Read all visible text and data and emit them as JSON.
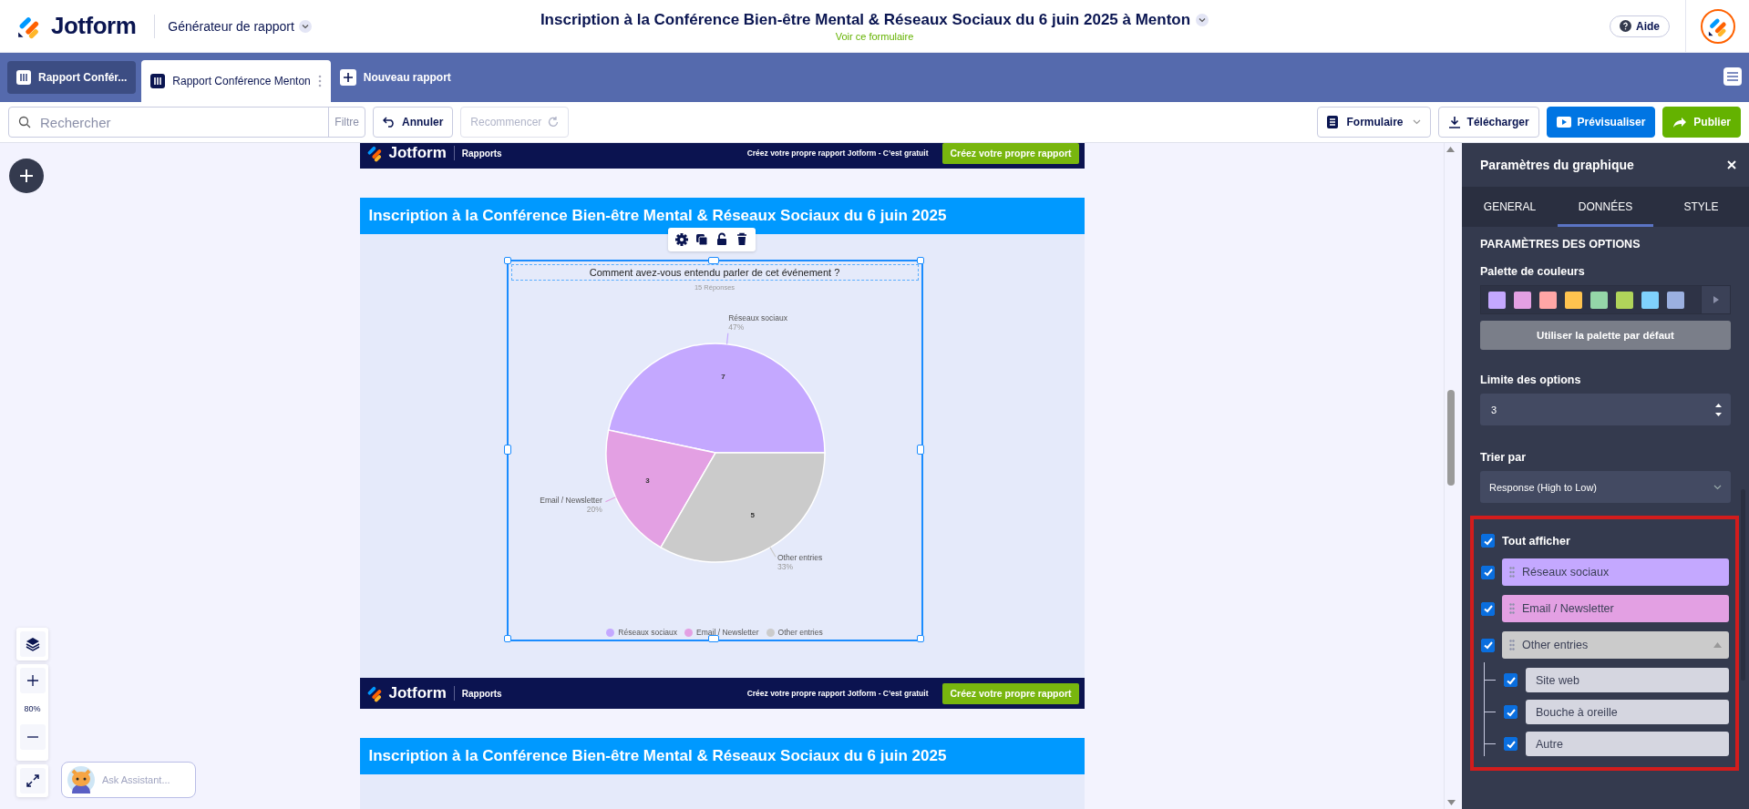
{
  "header": {
    "brand": "Jotform",
    "app_menu": "Générateur de rapport",
    "form_title": "Inscription à la Conférence Bien-être Mental & Réseaux Sociaux du 6 juin 2025 à Menton",
    "form_link": "Voir ce formulaire",
    "help": "Aide"
  },
  "tabs": [
    {
      "label": "Rapport Confér...",
      "selected": false
    },
    {
      "label": "Rapport Conférence Menton",
      "selected": true
    }
  ],
  "new_tab": "Nouveau rapport",
  "toolbar": {
    "search": {
      "placeholder": "Rechercher"
    },
    "filter": "Filtre",
    "undo": {
      "label": "Annuler",
      "disabled": false
    },
    "redo": {
      "label": "Recommencer",
      "disabled": true
    },
    "actions": [
      {
        "kind": "select",
        "label": "Formulaire"
      },
      {
        "kind": "download",
        "label": "Télécharger"
      },
      {
        "kind": "preview",
        "label": "Prévisualiser"
      },
      {
        "kind": "publish",
        "label": "Publier"
      }
    ]
  },
  "report": {
    "bands": [
      {
        "brand": "Jotform",
        "section": "Rapports",
        "promo": "Créez votre propre rapport Jotform - C’est gratuit",
        "cta": "Créez votre propre rapport"
      },
      {
        "brand": "Jotform",
        "section": "Rapports",
        "promo": "Créez votre propre rapport Jotform - C’est gratuit",
        "cta": "Créez votre propre rapport"
      }
    ],
    "pages": [
      {
        "title": "Inscription à la Conférence Bien-être Mental & Réseaux Sociaux du 6 juin 2025"
      },
      {
        "title": "Inscription à la Conférence Bien-être Mental & Réseaux Sociaux du 6 juin 2025"
      }
    ],
    "chart": {
      "responses": "15 Réponses",
      "percent_labels": [
        "47%",
        "20%",
        "33%"
      ],
      "chart_data": {
        "type": "pie",
        "title": "Comment avez-vous entendu parler de cet événement ?",
        "categories": [
          "Réseaux sociaux",
          "Email / Newsletter",
          "Other entries"
        ],
        "values": [
          7,
          3,
          5
        ],
        "data_labels": true
      },
      "legend": [
        {
          "label": "Réseaux sociaux",
          "color": "#c4a8ff"
        },
        {
          "label": "Email / Newsletter",
          "color": "#e3a0e3"
        },
        {
          "label": "Other entries",
          "color": "#cbcbcb"
        }
      ]
    }
  },
  "zoom": {
    "level": "80%"
  },
  "assistant": {
    "placeholder": "Ask Assistant..."
  },
  "panel": {
    "title": "Paramètres du graphique",
    "tabs": [
      {
        "label": "GENERAL",
        "selected": false
      },
      {
        "label": "DONNÉES",
        "selected": true
      },
      {
        "label": "STYLE",
        "selected": false
      }
    ],
    "section": "PARAMÈTRES DES OPTIONS",
    "palette_label": "Palette de couleurs",
    "palette": [
      {
        "color": "#c4a8ff"
      },
      {
        "color": "#e3a0e3"
      },
      {
        "color": "#ffa6a6"
      },
      {
        "color": "#ffc34f"
      },
      {
        "color": "#94d6a8"
      },
      {
        "color": "#b0d45a"
      },
      {
        "color": "#7fd1fc"
      },
      {
        "color": "#9bb0e0"
      }
    ],
    "default_palette": "Utiliser la palette par défaut",
    "limit_label": "Limite des options",
    "limit_value": "3",
    "sort_label": "Trier par",
    "sort_value": "Response (High to Low)",
    "show_all": {
      "label": "Tout afficher",
      "checked": true
    },
    "options": [
      {
        "label": "Réseaux sociaux",
        "color": "#c4a8ff",
        "checked": true
      },
      {
        "label": "Email / Newsletter",
        "color": "#e3a0e3",
        "checked": true
      },
      {
        "label": "Other entries",
        "color": "#cbcbcb",
        "checked": true,
        "expanded": true,
        "children": [
          {
            "label": "Site web",
            "checked": true
          },
          {
            "label": "Bouche à oreille",
            "checked": true
          },
          {
            "label": "Autre",
            "checked": true
          }
        ]
      }
    ]
  }
}
